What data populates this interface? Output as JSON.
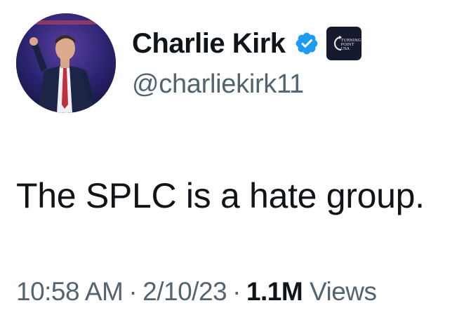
{
  "author": {
    "display_name": "Charlie Kirk",
    "handle": "@charliekirk11",
    "verified_icon": "verified-badge-icon",
    "affiliation": {
      "icon": "turning-point-usa-logo",
      "text": "TURNING POINT USA"
    }
  },
  "tweet": {
    "text": "The SPLC is a hate group."
  },
  "meta": {
    "time": "10:58 AM",
    "separator": "·",
    "date": "2/10/23",
    "views_count": "1.1M",
    "views_label": "Views"
  },
  "colors": {
    "text_primary": "#0f1419",
    "text_secondary": "#536471",
    "verified_blue": "#1d9bf0",
    "affiliate_bg": "#151a2e"
  }
}
